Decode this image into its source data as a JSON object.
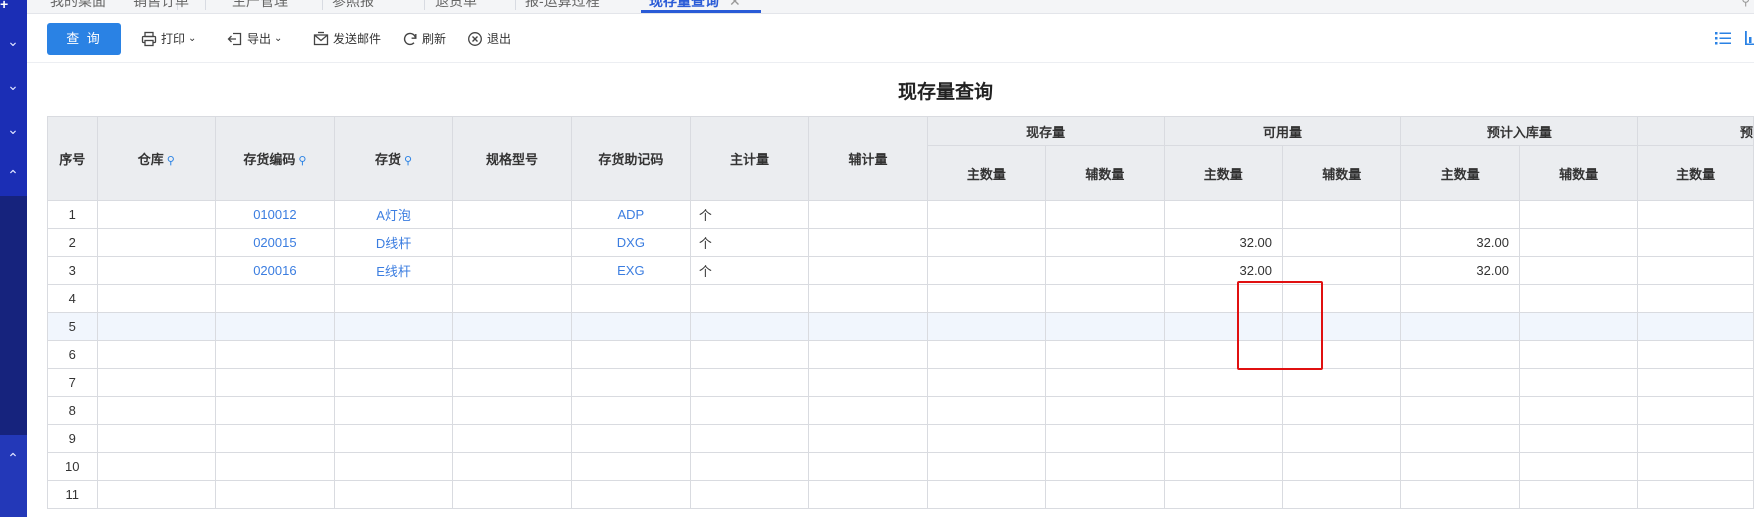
{
  "tabs": [
    {
      "label": "我的桌面",
      "active": false
    },
    {
      "label": "销售订单",
      "active": false
    },
    {
      "label": "生产管理",
      "active": false
    },
    {
      "label": "参照报",
      "active": false
    },
    {
      "label": "退货单",
      "active": false
    },
    {
      "label": "报-运算过程",
      "active": false
    },
    {
      "label": "现存量查询",
      "active": true
    }
  ],
  "toolbar": {
    "query_label": "查 询",
    "print_label": "打印",
    "export_label": "导出",
    "email_label": "发送邮件",
    "refresh_label": "刷新",
    "exit_label": "退出"
  },
  "page_title": "现存量查询",
  "table": {
    "headers": {
      "seq": "序号",
      "warehouse": "仓库",
      "item_code": "存货编码",
      "item": "存货",
      "spec": "规格型号",
      "mnemonic": "存货助记码",
      "main_unit": "主计量",
      "aux_unit": "辅计量",
      "group_onhand": "现存量",
      "group_available": "可用量",
      "group_expected_in": "预计入库量",
      "group_cut": "预",
      "main_qty": "主数量",
      "aux_qty": "辅数量"
    },
    "rows": [
      {
        "seq": "1",
        "warehouse": "",
        "code": "010012",
        "item": "A灯泡",
        "spec": "",
        "mnemonic": "ADP",
        "unit": "个",
        "aux_unit": "",
        "onhand_main": "",
        "onhand_aux": "",
        "avail_main": "",
        "avail_aux": "",
        "exp_main": "",
        "exp_aux": "",
        "last_main": ""
      },
      {
        "seq": "2",
        "warehouse": "",
        "code": "020015",
        "item": "D线杆",
        "spec": "",
        "mnemonic": "DXG",
        "unit": "个",
        "aux_unit": "",
        "onhand_main": "",
        "onhand_aux": "",
        "avail_main": "32.00",
        "avail_aux": "",
        "exp_main": "32.00",
        "exp_aux": "",
        "last_main": ""
      },
      {
        "seq": "3",
        "warehouse": "",
        "code": "020016",
        "item": "E线杆",
        "spec": "",
        "mnemonic": "EXG",
        "unit": "个",
        "aux_unit": "",
        "onhand_main": "",
        "onhand_aux": "",
        "avail_main": "32.00",
        "avail_aux": "",
        "exp_main": "32.00",
        "exp_aux": "",
        "last_main": ""
      },
      {
        "seq": "4"
      },
      {
        "seq": "5"
      },
      {
        "seq": "6"
      },
      {
        "seq": "7"
      },
      {
        "seq": "8"
      },
      {
        "seq": "9"
      },
      {
        "seq": "10"
      },
      {
        "seq": "11"
      }
    ]
  },
  "colors": {
    "accent": "#2a82e4",
    "link": "#3b7de0",
    "sidebar": "#16237d",
    "highlight_box": "#e01010"
  }
}
